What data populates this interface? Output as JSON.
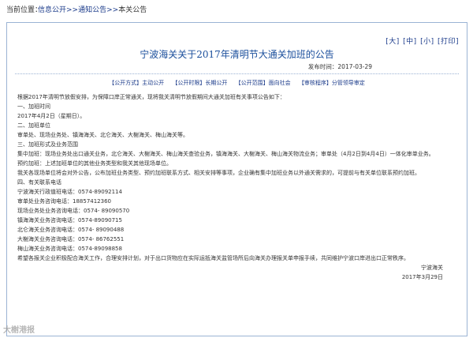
{
  "breadcrumb": {
    "label": "当前位置：",
    "items": [
      "信息公开",
      ">>",
      "通知公告",
      ">>"
    ],
    "current": "本关公告"
  },
  "font_controls": [
    "[大]",
    "[中]",
    "[小]",
    "[打印]"
  ],
  "title": "宁波海关关于2017年清明节大通关加班的公告",
  "publish": "发布时间：2017-03-29",
  "info": [
    {
      "key": "【公开方式】",
      "value": "主动公开"
    },
    {
      "key": "【公开时限】",
      "value": "长期公开"
    },
    {
      "key": "【公开范围】",
      "value": "面向社会"
    },
    {
      "key": "【审核程序】",
      "value": "分管领导审定"
    }
  ],
  "body": [
    "根据2017年清明节放假安排，为保障口岸正常通关，现将我关清明节放假期间大通关加班有关事项公告如下：",
    "一、加班时间",
    "2017年4月2日（星期日）。",
    "二、加班单位",
    "审单处、现场业务处、镇海海关、北仑海关、大榭海关、梅山海关等。",
    "三、加班形式及业务范围",
    "集中加班：现场业务处出口通关业务，北仑海关、大榭海关、梅山海关查验业务，镇海海关、大榭海关、梅山海关物流业务；审单处（4月2日到4月4日）一体化审单业务。",
    "预约加班：上述加班单位的其他业务类型和我关其他现场单位。",
    "我关各现场单位将会对外公告，公布加班业务类型、预约加班联系方式、相关安排等事项，企业确有集中加班业务以外通关需求的，可提前与有关单位联系预约加班。",
    "四、有关联系电话",
    "宁波海关行政值班电话：0574-89092114",
    "审单处业务咨询电话：18857412360",
    "现场业务处业务咨询电话：0574- 89090570",
    "镇海海关业务咨询电话：0574-89090715",
    "北仑海关业务咨询电话：0574- 89090488",
    "大榭海关业务咨询电话：0574- 86762551",
    "梅山海关业务咨询电话：0574-89098858",
    "希望各报关企业积极配合海关工作，合理安排计划，对于出口货物应在实际运抵海关监管场所后向海关办理报关单申报手续，共同维护宁波口岸进出口正常秩序。"
  ],
  "signature": {
    "org": "宁波海关",
    "date": "2017年3月29日"
  },
  "watermark": "大榭港报"
}
